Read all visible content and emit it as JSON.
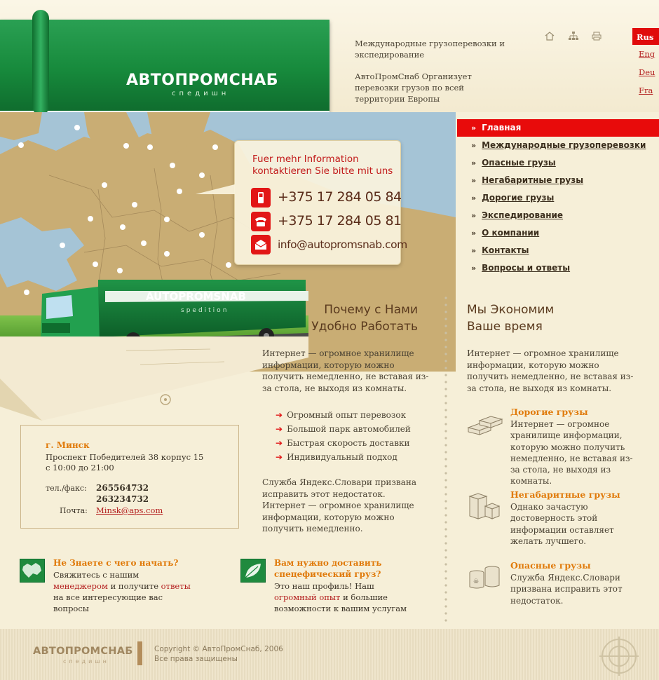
{
  "header": {
    "logo_word": "АВТОПРОМСНАБ",
    "logo_sub": "спедишн",
    "tagline_1": "Международные грузоперевозки и экспедирование",
    "tagline_2": "АвтоПромСнаб Организует перевозки грузов по всей территории Европы",
    "icons": [
      "home-icon",
      "sitemap-icon",
      "print-icon"
    ]
  },
  "languages": [
    {
      "label": "Rus",
      "active": true
    },
    {
      "label": "Eng"
    },
    {
      "label": "Deu"
    },
    {
      "label": "Fra"
    }
  ],
  "contact_bubble": {
    "title": "Fuer mehr Information kontaktieren Sie bitte mit uns",
    "phone_1": "+375 17 284 05 84",
    "phone_2": "+375 17 284 05 81",
    "email": "info@autopromsnab.com"
  },
  "truck": {
    "brand": "AUTOPROMSNAB",
    "brand_sub": "spedition"
  },
  "nav": {
    "items": [
      {
        "label": "Главная",
        "active": true
      },
      {
        "label": "Международные грузоперевозки"
      },
      {
        "label": "Опасные грузы"
      },
      {
        "label": "Негабаритные грузы"
      },
      {
        "label": "Дорогие грузы"
      },
      {
        "label": "Экспедирование"
      },
      {
        "label": "О компании"
      },
      {
        "label": "Контакты"
      },
      {
        "label": "Вопросы и ответы"
      }
    ]
  },
  "why": {
    "title_1": "Почему с Нами",
    "title_2": "Удобно Работать",
    "text": "Интернет — огромное хранилище информации, которую можно получить немедленно, не вставая из-за стола, не выходя из комнаты.",
    "list": [
      "Огромный опыт перевозок",
      "Большой парк автомобилей",
      "Быстрая скорость доставки",
      "Индивидуальный подход"
    ],
    "text_2": "Служба Яндекс.Словари призвана исправить этот недостаток. Интернет — огромное хранилище информации, которую можно получить немедленно."
  },
  "save": {
    "title_1": "Мы Экономим",
    "title_2": "Ваше время",
    "text": "Интернет — огромное хранилище информации, которую можно получить немедленно, не вставая из-за стола, не выходя из комнаты.",
    "features": [
      {
        "title": "Дорогие грузы",
        "text": "Интернет — огромное хранилище информации, которую можно получить немедленно, не вставая из-за стола, не выходя из комнаты."
      },
      {
        "title": "Негабаритные грузы",
        "text": "Однако зачастую достоверность этой информации оставляет желать лучшего."
      },
      {
        "title": "Опасные грузы",
        "text": "Служба Яндекс.Словари призвана исправить этот недостаток."
      }
    ]
  },
  "address": {
    "city": "г. Минск",
    "street": "Проспект Победителей 38 корпус 15",
    "hours": "с 10:00 до 21:00",
    "phone_label": "тел./факс:",
    "phone_1": "265564732",
    "phone_2": "263234732",
    "mail_label": "Почта:",
    "mail": "Minsk@aps.com"
  },
  "promo_1": {
    "title": "Не Знаете с чего начать?",
    "text_before": "Свяжитесь с нашим ",
    "link_1": "менеджером",
    "text_mid": " и получите ",
    "link_2": "ответы",
    "text_after": " на все интересующие вас вопросы"
  },
  "promo_2": {
    "title": "Вам нужно доставить спецефический груз?",
    "text_before": "Это наш профиль! Наш ",
    "link_1": "огромный опыт",
    "text_after": " и большие возможности к вашим услугам"
  },
  "footer": {
    "logo_word": "АВТОПРОМСНАБ",
    "logo_sub": "спедишн",
    "copyright": "Copyright © АвтоПромСнаб, 2006",
    "rights": "Все права защищены"
  },
  "colors": {
    "accent_red": "#e80b0b",
    "brand_green": "#178a3c",
    "orange_title": "#e07a0a",
    "background": "#f6efd8"
  }
}
